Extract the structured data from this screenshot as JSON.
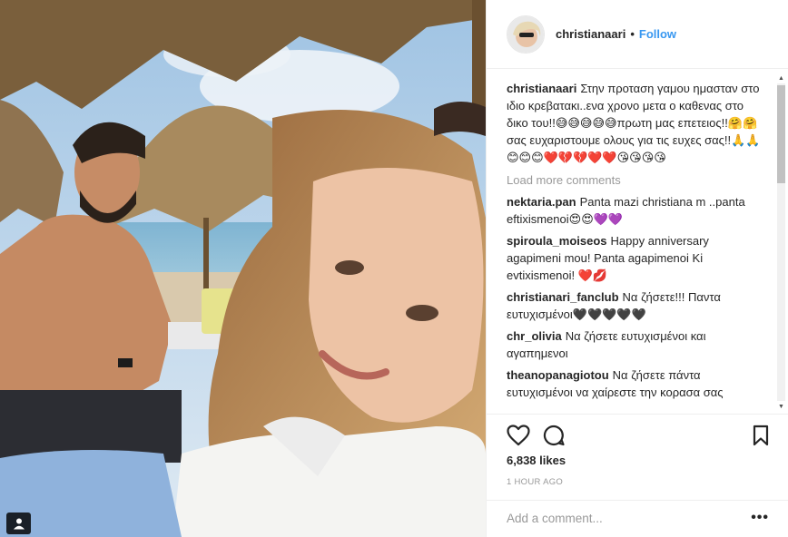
{
  "header": {
    "username": "christianaari",
    "dot": "•",
    "follow_label": "Follow"
  },
  "caption": {
    "username": "christianaari",
    "text": "Στην προταση γαμου ημασταν στο ιδιο κρεβατακι..ενα χρονο μετα ο καθενας στο δικο του!!😅😅😅😅😅πρωτη μας επετειος!!🤗🤗σας ευχαριστουμε ολους για τις ευχες σας!!🙏🙏😊😊😊❤️💔💔❤️❤️😘😘😘😘"
  },
  "load_more_label": "Load more comments",
  "comments": [
    {
      "username": "nektaria.pan",
      "text": "Panta mazi christiana m ..panta eftixismenoi😍😍💜💜"
    },
    {
      "username": "spiroula_moiseos",
      "text": "Happy anniversary agapimeni mou! Panta agapimenoi Ki evtixismenoi! ❤️💋"
    },
    {
      "username": "christianari_fanclub",
      "text": "Να ζήσετε!!! Παντα ευτυχισμένοι🖤🖤🖤🖤🖤"
    },
    {
      "username": "chr_olivia",
      "text": "Να ζήσετε ευτυχισμένοι και αγαπημενοι"
    },
    {
      "username": "theanopanagiotou",
      "text": "Να ζήσετε πάντα ευτυχισμένοι να χαίρεστε την κορασα σας"
    }
  ],
  "likes": "6,838 likes",
  "timestamp": "1 HOUR AGO",
  "add_comment_placeholder": "Add a comment...",
  "more_options": "•••",
  "icons": {
    "like": "heart-icon",
    "comment": "comment-icon",
    "save": "bookmark-icon",
    "tagged": "person-tag-icon"
  },
  "colors": {
    "accent": "#3897f0",
    "text": "#262626",
    "muted": "#999999",
    "border": "#efefef"
  }
}
